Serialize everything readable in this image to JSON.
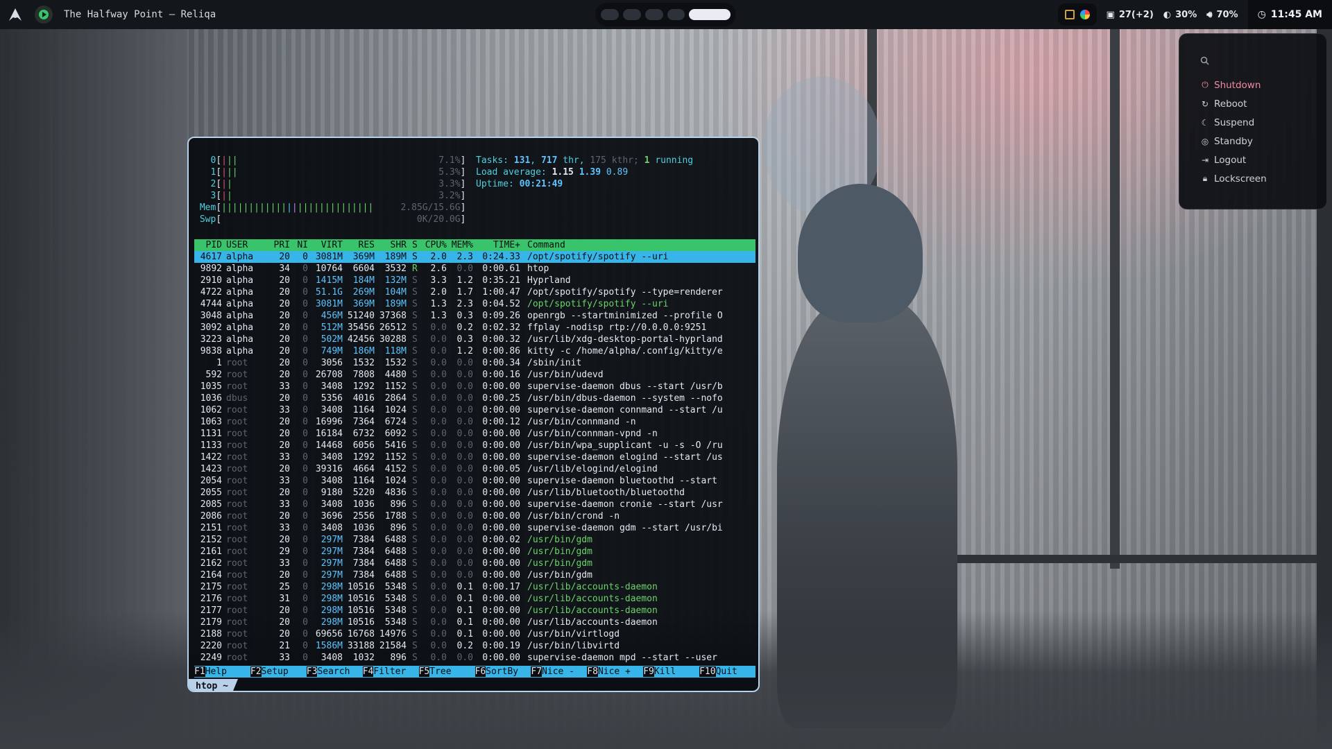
{
  "topbar": {
    "window_title": "The Halfway Point — Reliqa",
    "workspaces": [
      {
        "active": false
      },
      {
        "active": false
      },
      {
        "active": false
      },
      {
        "active": false
      },
      {
        "active": true
      }
    ],
    "updates": "27(+2)",
    "brightness": "30%",
    "volume": "70%",
    "clock": "11:45 AM"
  },
  "power_menu": {
    "items": [
      "Shutdown",
      "Reboot",
      "Suspend",
      "Standby",
      "Logout",
      "Lockscreen"
    ]
  },
  "htop": {
    "cpus": [
      {
        "id": "0",
        "pct": "7.1%"
      },
      {
        "id": "1",
        "pct": "5.3%"
      },
      {
        "id": "2",
        "pct": "3.3%"
      },
      {
        "id": "3",
        "pct": "3.2%"
      }
    ],
    "mem": {
      "label": "Mem",
      "value": "2.85G/15.6G"
    },
    "swp": {
      "label": "Swp",
      "value": "0K/20.0G"
    },
    "tasks": {
      "label": "Tasks:",
      "tasks": "131",
      "thr": "717",
      "thr_label": "thr,",
      "kthr": "175 kthr;",
      "running": "1",
      "running_label": "running"
    },
    "load": {
      "label": "Load average:",
      "v1": "1.15",
      "v5": "1.39",
      "v15": "0.89"
    },
    "uptime": {
      "label": "Uptime:",
      "value": "00:21:49"
    },
    "columns": [
      "PID",
      "USER",
      "PRI",
      "NI",
      "VIRT",
      "RES",
      "SHR",
      "S",
      "CPU%",
      "MEM%",
      "TIME+",
      "Command"
    ],
    "processes": [
      [
        "4617",
        "alpha",
        "20",
        "0",
        "3081M",
        "369M",
        "189M",
        "S",
        "2.0",
        "2.3",
        "0:24.33",
        "/opt/spotify/spotify --uri"
      ],
      [
        "9892",
        "alpha",
        "34",
        "0",
        "10764",
        "6604",
        "3532",
        "R",
        "2.6",
        "0.0",
        "0:00.61",
        "htop"
      ],
      [
        "2910",
        "alpha",
        "20",
        "0",
        "1415M",
        "184M",
        "132M",
        "S",
        "3.3",
        "1.2",
        "0:35.21",
        "Hyprland"
      ],
      [
        "4722",
        "alpha",
        "20",
        "0",
        "51.1G",
        "269M",
        "104M",
        "S",
        "2.0",
        "1.7",
        "1:00.47",
        "/opt/spotify/spotify --type=renderer"
      ],
      [
        "4744",
        "alpha",
        "20",
        "0",
        "3081M",
        "369M",
        "189M",
        "S",
        "1.3",
        "2.3",
        "0:04.52",
        "/opt/spotify/spotify --uri"
      ],
      [
        "3048",
        "alpha",
        "20",
        "0",
        "456M",
        "51240",
        "37368",
        "S",
        "1.3",
        "0.3",
        "0:09.26",
        "openrgb --startminimized --profile O"
      ],
      [
        "3092",
        "alpha",
        "20",
        "0",
        "512M",
        "35456",
        "26512",
        "S",
        "0.0",
        "0.2",
        "0:02.32",
        "ffplay -nodisp rtp://0.0.0.0:9251"
      ],
      [
        "3223",
        "alpha",
        "20",
        "0",
        "502M",
        "42456",
        "30288",
        "S",
        "0.0",
        "0.3",
        "0:00.32",
        "/usr/lib/xdg-desktop-portal-hyprland"
      ],
      [
        "9838",
        "alpha",
        "20",
        "0",
        "749M",
        "186M",
        "118M",
        "S",
        "0.0",
        "1.2",
        "0:00.86",
        "kitty -c /home/alpha/.config/kitty/e"
      ],
      [
        "1",
        "root",
        "20",
        "0",
        "3056",
        "1532",
        "1532",
        "S",
        "0.0",
        "0.0",
        "0:00.34",
        "/sbin/init"
      ],
      [
        "592",
        "root",
        "20",
        "0",
        "26708",
        "7808",
        "4480",
        "S",
        "0.0",
        "0.0",
        "0:00.16",
        "/usr/bin/udevd"
      ],
      [
        "1035",
        "root",
        "33",
        "0",
        "3408",
        "1292",
        "1152",
        "S",
        "0.0",
        "0.0",
        "0:00.00",
        "supervise-daemon dbus --start /usr/b"
      ],
      [
        "1036",
        "dbus",
        "20",
        "0",
        "5356",
        "4016",
        "2864",
        "S",
        "0.0",
        "0.0",
        "0:00.25",
        "/usr/bin/dbus-daemon --system --nofo"
      ],
      [
        "1062",
        "root",
        "33",
        "0",
        "3408",
        "1164",
        "1024",
        "S",
        "0.0",
        "0.0",
        "0:00.00",
        "supervise-daemon connmand --start /u"
      ],
      [
        "1063",
        "root",
        "20",
        "0",
        "16996",
        "7364",
        "6724",
        "S",
        "0.0",
        "0.0",
        "0:00.12",
        "/usr/bin/connmand -n"
      ],
      [
        "1131",
        "root",
        "20",
        "0",
        "16184",
        "6732",
        "6092",
        "S",
        "0.0",
        "0.0",
        "0:00.00",
        "/usr/bin/connman-vpnd -n"
      ],
      [
        "1133",
        "root",
        "20",
        "0",
        "14468",
        "6056",
        "5416",
        "S",
        "0.0",
        "0.0",
        "0:00.00",
        "/usr/bin/wpa_supplicant -u -s -O /ru"
      ],
      [
        "1422",
        "root",
        "33",
        "0",
        "3408",
        "1292",
        "1152",
        "S",
        "0.0",
        "0.0",
        "0:00.00",
        "supervise-daemon elogind --start /us"
      ],
      [
        "1423",
        "root",
        "20",
        "0",
        "39316",
        "4664",
        "4152",
        "S",
        "0.0",
        "0.0",
        "0:00.05",
        "/usr/lib/elogind/elogind"
      ],
      [
        "2054",
        "root",
        "33",
        "0",
        "3408",
        "1164",
        "1024",
        "S",
        "0.0",
        "0.0",
        "0:00.00",
        "supervise-daemon bluetoothd --start"
      ],
      [
        "2055",
        "root",
        "20",
        "0",
        "9180",
        "5220",
        "4836",
        "S",
        "0.0",
        "0.0",
        "0:00.00",
        "/usr/lib/bluetooth/bluetoothd"
      ],
      [
        "2085",
        "root",
        "33",
        "0",
        "3408",
        "1036",
        "896",
        "S",
        "0.0",
        "0.0",
        "0:00.00",
        "supervise-daemon cronie --start /usr"
      ],
      [
        "2086",
        "root",
        "20",
        "0",
        "3696",
        "2556",
        "1788",
        "S",
        "0.0",
        "0.0",
        "0:00.00",
        "/usr/bin/crond -n"
      ],
      [
        "2151",
        "root",
        "33",
        "0",
        "3408",
        "1036",
        "896",
        "S",
        "0.0",
        "0.0",
        "0:00.00",
        "supervise-daemon gdm --start /usr/bi"
      ],
      [
        "2152",
        "root",
        "20",
        "0",
        "297M",
        "7384",
        "6488",
        "S",
        "0.0",
        "0.0",
        "0:00.02",
        "/usr/bin/gdm"
      ],
      [
        "2161",
        "root",
        "29",
        "0",
        "297M",
        "7384",
        "6488",
        "S",
        "0.0",
        "0.0",
        "0:00.00",
        "/usr/bin/gdm"
      ],
      [
        "2162",
        "root",
        "33",
        "0",
        "297M",
        "7384",
        "6488",
        "S",
        "0.0",
        "0.0",
        "0:00.00",
        "/usr/bin/gdm"
      ],
      [
        "2164",
        "root",
        "20",
        "0",
        "297M",
        "7384",
        "6488",
        "S",
        "0.0",
        "0.0",
        "0:00.00",
        "/usr/bin/gdm"
      ],
      [
        "2175",
        "root",
        "25",
        "0",
        "298M",
        "10516",
        "5348",
        "S",
        "0.0",
        "0.1",
        "0:00.17",
        "/usr/lib/accounts-daemon"
      ],
      [
        "2176",
        "root",
        "31",
        "0",
        "298M",
        "10516",
        "5348",
        "S",
        "0.0",
        "0.1",
        "0:00.00",
        "/usr/lib/accounts-daemon"
      ],
      [
        "2177",
        "root",
        "20",
        "0",
        "298M",
        "10516",
        "5348",
        "S",
        "0.0",
        "0.1",
        "0:00.00",
        "/usr/lib/accounts-daemon"
      ],
      [
        "2179",
        "root",
        "20",
        "0",
        "298M",
        "10516",
        "5348",
        "S",
        "0.0",
        "0.1",
        "0:00.00",
        "/usr/lib/accounts-daemon"
      ],
      [
        "2188",
        "root",
        "20",
        "0",
        "69656",
        "16768",
        "14976",
        "S",
        "0.0",
        "0.1",
        "0:00.00",
        "/usr/bin/virtlogd"
      ],
      [
        "2220",
        "root",
        "21",
        "0",
        "1586M",
        "33188",
        "21584",
        "S",
        "0.0",
        "0.2",
        "0:00.19",
        "/usr/bin/libvirtd"
      ],
      [
        "2249",
        "root",
        "33",
        "0",
        "3408",
        "1032",
        "896",
        "S",
        "0.0",
        "0.0",
        "0:00.00",
        "supervise-daemon mpd --start --user"
      ]
    ],
    "thread_rows": [
      4,
      24,
      25,
      26,
      28,
      29,
      30
    ],
    "fkeys": [
      {
        "key": "F1",
        "label": "Help"
      },
      {
        "key": "F2",
        "label": "Setup"
      },
      {
        "key": "F3",
        "label": "Search"
      },
      {
        "key": "F4",
        "label": "Filter"
      },
      {
        "key": "F5",
        "label": "Tree"
      },
      {
        "key": "F6",
        "label": "SortBy"
      },
      {
        "key": "F7",
        "label": "Nice -"
      },
      {
        "key": "F8",
        "label": "Nice +"
      },
      {
        "key": "F9",
        "label": "Kill"
      },
      {
        "key": "F10",
        "label": "Quit"
      }
    ],
    "tab_label": "htop ~"
  },
  "colors": {
    "accent_blue": "#37b5e8",
    "header_green": "#39c46c",
    "power_accent": "#f08aa0",
    "border": "#b8d0e8"
  }
}
